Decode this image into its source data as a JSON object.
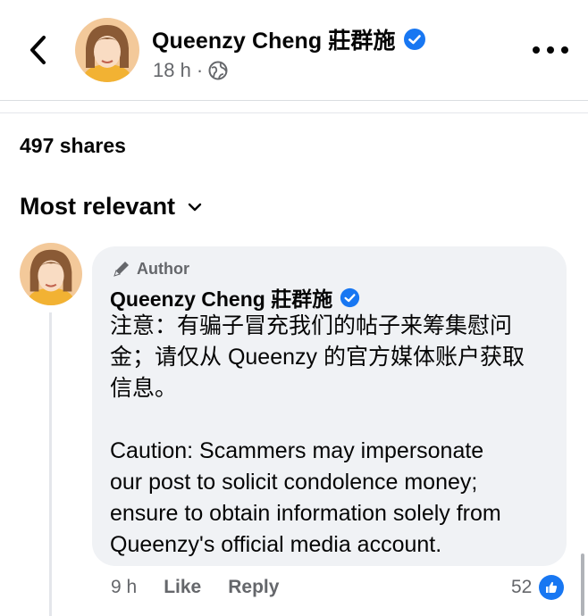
{
  "header": {
    "author": "Queenzy Cheng 莊群施",
    "time": "18 h",
    "separator": "·",
    "audience_icon": "globe-icon",
    "back_icon": "chevron-left-icon",
    "more_icon": "more-horizontal-icon"
  },
  "post": {
    "shares": "497 shares"
  },
  "sort": {
    "label": "Most relevant",
    "icon": "chevron-down-icon"
  },
  "comment": {
    "badge": "Author",
    "badge_icon": "pen-icon",
    "name": "Queenzy Cheng 莊群施",
    "verified_icon": "verified-badge-icon",
    "text_zh_1": "注意：有骗子冒充我们的帖子来筹集慰问",
    "text_zh_2": "金；请仅从 Queenzy 的官方媒体账户获取",
    "text_zh_3": "信息。",
    "text_en_1": "Caution: Scammers may impersonate",
    "text_en_2": "our post to solicit condolence money;",
    "text_en_3": "ensure to obtain information solely from",
    "text_en_4": "Queenzy's official media account.",
    "time": "9 h",
    "like_label": "Like",
    "reply_label": "Reply",
    "reaction_count": "52",
    "reaction_icon": "thumbs-up-icon"
  },
  "colors": {
    "accent": "#1877f2",
    "secondary_text": "#65676b",
    "bubble_bg": "#f0f2f5"
  }
}
